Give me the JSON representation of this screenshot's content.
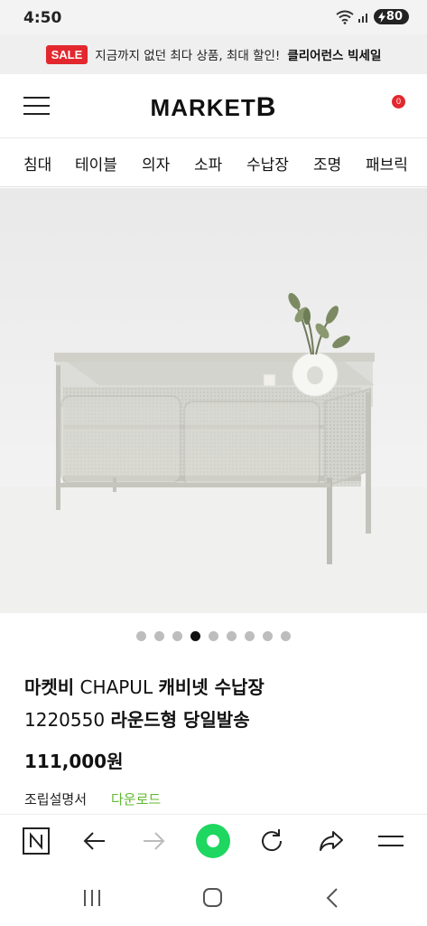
{
  "status_bar": {
    "time": "4:50",
    "battery": "80"
  },
  "promo": {
    "badge": "SALE",
    "text": "지금까지 없던 최다 상품, 최대 할인!",
    "highlight": "클리어런스 빅세일"
  },
  "header": {
    "logo_main": "MARKET",
    "logo_letter": "B",
    "cart_count": "0",
    "menu_icon": "hamburger-menu-icon",
    "cart_icon": "shopping-bag-icon"
  },
  "categories": [
    "침대",
    "테이블",
    "의자",
    "소파",
    "수납장",
    "조명",
    "패브릭"
  ],
  "carousel": {
    "total": 9,
    "active_index": 4
  },
  "product": {
    "title_line1_bold": "마켓비",
    "title_line1_rest": " CHAPUL ",
    "title_line1_bold2": "캐비넷 수납장",
    "title_line2_num": "1220550 ",
    "title_line2_bold": "라운드형 당일발송",
    "price": "111,000원",
    "manual_label": "조립설명서",
    "manual_link": "다운로드"
  },
  "colors": {
    "sale": "#e2282e",
    "link_green": "#5fb92f",
    "naver_green": "#1ed760"
  },
  "browser_toolbar": {
    "icons": [
      "naver-n-icon",
      "back-arrow-icon",
      "forward-arrow-icon",
      "home-green-circle-icon",
      "reload-icon",
      "share-icon",
      "menu-icon"
    ]
  },
  "android_nav": {
    "icons": [
      "recent-apps-icon",
      "home-icon",
      "back-icon"
    ]
  }
}
